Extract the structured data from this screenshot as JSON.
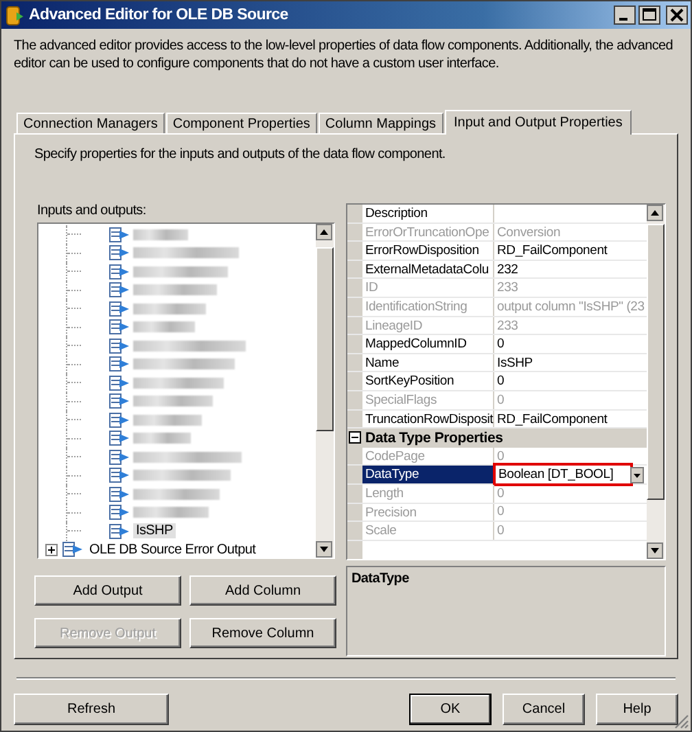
{
  "window": {
    "title": "Advanced Editor for OLE DB Source"
  },
  "description": "The advanced editor provides access to the low-level properties of data flow components. Additionally, the advanced editor can be used to configure components that do not have a custom user interface.",
  "tabs": [
    {
      "label": "Connection Managers",
      "selected": false
    },
    {
      "label": "Component Properties",
      "selected": false
    },
    {
      "label": "Column Mappings",
      "selected": false
    },
    {
      "label": "Input and Output Properties",
      "selected": true
    }
  ],
  "instruction": "Specify properties for the inputs and outputs of the data flow component.",
  "tree": {
    "label": "Inputs and outputs:",
    "column_items": [
      {
        "kind": "redacted",
        "selected": false
      },
      {
        "kind": "redacted",
        "selected": false
      },
      {
        "kind": "redacted",
        "selected": false
      },
      {
        "kind": "redacted",
        "selected": false
      },
      {
        "kind": "redacted",
        "selected": false
      },
      {
        "kind": "redacted",
        "selected": false
      },
      {
        "kind": "redacted",
        "selected": false
      },
      {
        "kind": "redacted",
        "selected": false
      },
      {
        "kind": "redacted",
        "selected": false
      },
      {
        "kind": "redacted",
        "selected": false
      },
      {
        "kind": "redacted",
        "selected": false
      },
      {
        "kind": "redacted",
        "selected": false
      },
      {
        "kind": "redacted",
        "selected": false
      },
      {
        "kind": "redacted",
        "selected": false
      },
      {
        "kind": "redacted",
        "selected": false
      },
      {
        "kind": "redacted",
        "selected": false
      },
      {
        "kind": "column",
        "label": "IsSHP",
        "selected": true
      }
    ],
    "outputs": [
      {
        "label": "OLE DB Source Error Output",
        "expanded": false
      }
    ]
  },
  "properties": {
    "rows": [
      {
        "name": "Description",
        "readonly": false,
        "selected": false
      },
      {
        "name": "ErrorOrTruncationOpe",
        "value": "Conversion",
        "readonly": true,
        "selected": false
      },
      {
        "name": "ErrorRowDisposition",
        "value": "RD_FailComponent",
        "readonly": false,
        "selected": false
      },
      {
        "name": "ExternalMetadataColu",
        "value": "232",
        "readonly": false,
        "selected": false
      },
      {
        "name": "ID",
        "value": "233",
        "readonly": true,
        "selected": false
      },
      {
        "name": "IdentificationString",
        "value": "output column \"IsSHP\" (23",
        "readonly": true,
        "selected": false
      },
      {
        "name": "LineageID",
        "value": "233",
        "readonly": true,
        "selected": false
      },
      {
        "name": "MappedColumnID",
        "value": "0",
        "readonly": false,
        "selected": false
      },
      {
        "name": "Name",
        "value": "IsSHP",
        "readonly": false,
        "selected": false
      },
      {
        "name": "SortKeyPosition",
        "value": "0",
        "readonly": false,
        "selected": false
      },
      {
        "name": "SpecialFlags",
        "value": "0",
        "readonly": true,
        "selected": false
      },
      {
        "name": "TruncationRowDisposit",
        "value": "RD_FailComponent",
        "readonly": false,
        "selected": false
      }
    ],
    "categories": [
      {
        "name": "Data Type Properties",
        "expanded": true,
        "rows": [
          {
            "name": "CodePage",
            "value": "0",
            "readonly": true,
            "selected": false
          },
          {
            "name": "DataType",
            "value": "Boolean [DT_BOOL]",
            "readonly": false,
            "selected": true,
            "highlighted": true
          },
          {
            "name": "Length",
            "value": "0",
            "readonly": true,
            "selected": false
          },
          {
            "name": "Precision",
            "value": "0",
            "readonly": true,
            "selected": false
          },
          {
            "name": "Scale",
            "value": "0",
            "readonly": true,
            "selected": false
          }
        ]
      }
    ]
  },
  "help_pane": {
    "title": "DataType"
  },
  "tree_buttons": [
    {
      "label": "Add Output",
      "disabled": false
    },
    {
      "label": "Add Column",
      "disabled": false
    },
    {
      "label": "Remove Output",
      "disabled": true
    },
    {
      "label": "Remove Column",
      "disabled": false
    }
  ],
  "footer_buttons": [
    {
      "label": "Refresh",
      "default": false
    },
    {
      "label": "OK",
      "default": true
    },
    {
      "label": "Cancel",
      "default": false
    },
    {
      "label": "Help",
      "default": false
    }
  ]
}
